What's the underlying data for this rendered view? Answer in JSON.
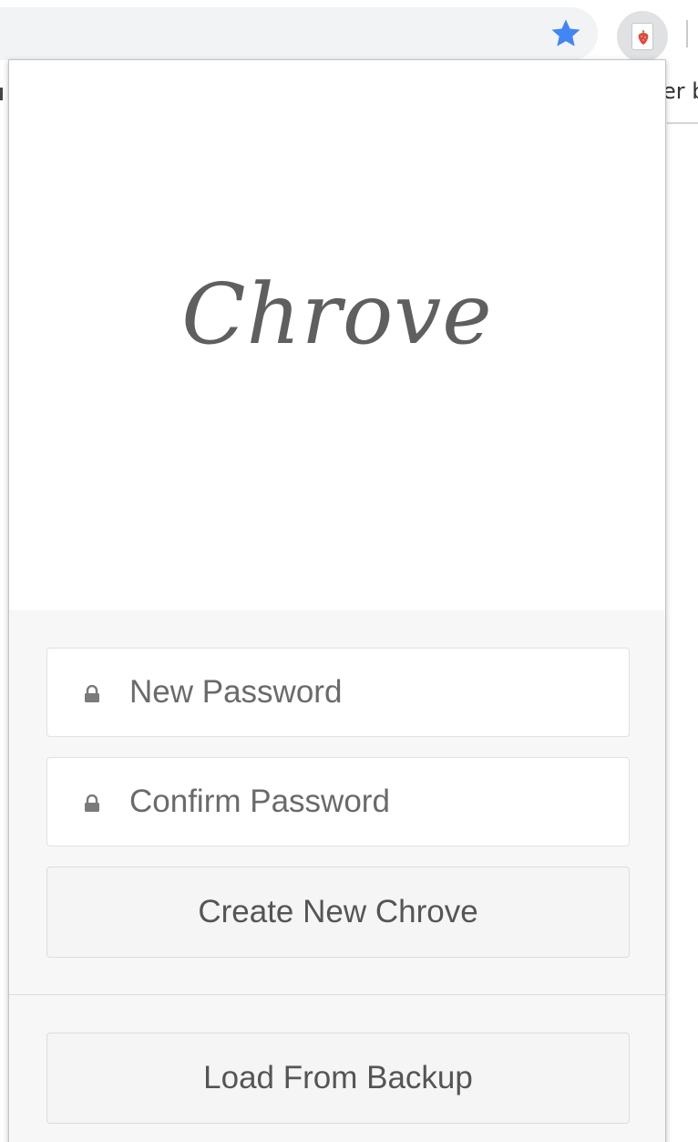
{
  "browser": {
    "omnibox_star_icon": "star-icon",
    "extension_icon": "strawberry-icon",
    "background_text": "er b"
  },
  "popup": {
    "logo_text": "Chrove",
    "new_password": {
      "placeholder": "New Password",
      "value": "",
      "icon": "lock-icon"
    },
    "confirm_password": {
      "placeholder": "Confirm Password",
      "value": "",
      "icon": "lock-icon"
    },
    "create_button_label": "Create New Chrove",
    "load_backup_label": "Load From Backup"
  },
  "colors": {
    "star": "#4285f4",
    "logo": "#5f5f5f",
    "form_background": "#f7f7f7",
    "button_background": "#f5f5f5",
    "extension_fruit": "#e0483b"
  }
}
